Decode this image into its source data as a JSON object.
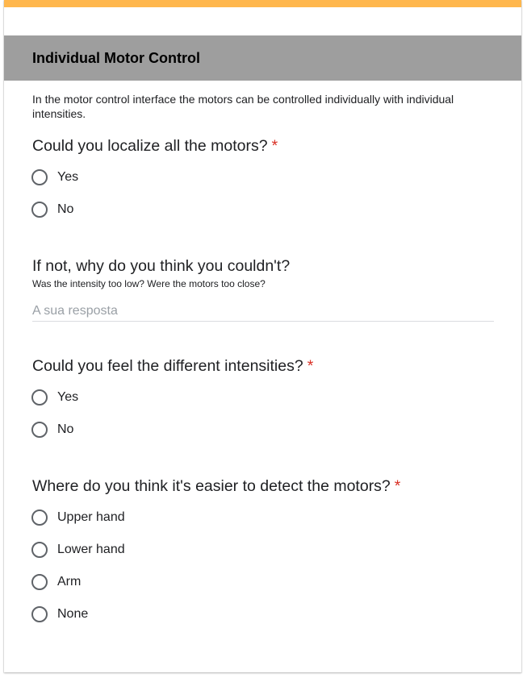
{
  "section": {
    "title": "Individual Motor Control",
    "description": "In the motor control interface the motors can be controlled individually with individual intensities."
  },
  "questions": [
    {
      "title": "Could you localize all the motors?",
      "required": "*",
      "options": [
        "Yes",
        "No"
      ]
    },
    {
      "title": "If not, why do you think you couldn't?",
      "help": "Was the intensity too low? Were the motors too close?",
      "placeholder": "A sua resposta"
    },
    {
      "title": "Could you feel the different intensities?",
      "required": "*",
      "options": [
        "Yes",
        "No"
      ]
    },
    {
      "title": "Where do you think it's easier to detect the motors?",
      "required": "*",
      "options": [
        "Upper hand",
        "Lower hand",
        "Arm",
        "None"
      ]
    }
  ],
  "colors": {
    "accent": "#ffb74d",
    "header_bg": "#9e9e9e",
    "required": "#d93025"
  }
}
